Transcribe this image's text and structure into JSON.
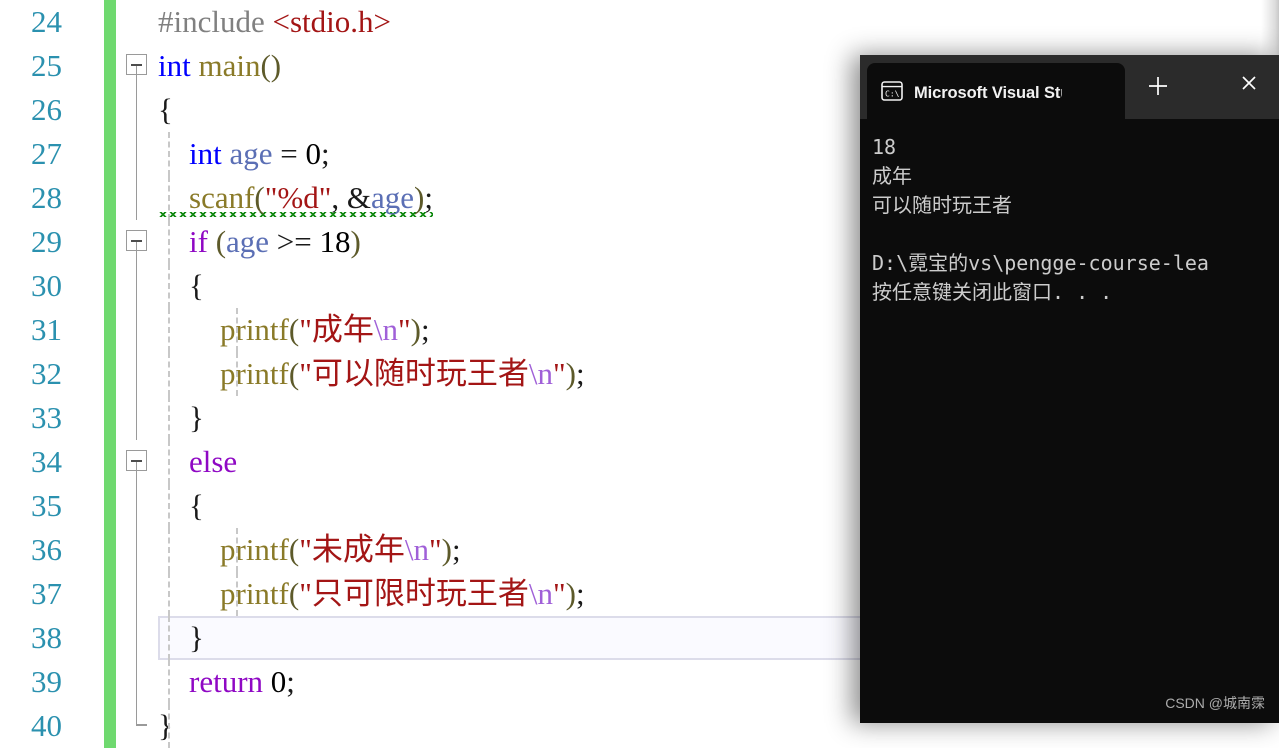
{
  "editor": {
    "name": "visual-studio-code-editor",
    "language": "C",
    "first_visible_line": 24,
    "current_line": 38,
    "colors": {
      "background": "#ffffff",
      "line_number": "#2b91af",
      "change_bar_saved": "#6fd96f",
      "keyword": "#0000ff",
      "control_keyword": "#8f08c4",
      "function": "#8a7a28",
      "string": "#a31515",
      "escape": "#a060d8",
      "preprocessor": "#808080",
      "variable": "#5b6fb5",
      "squiggle_error": "#128a12",
      "current_line_border": "#dcdcea"
    },
    "lines": [
      {
        "num": "24",
        "fold": "none",
        "indent_guides": 0,
        "tokens": [
          {
            "t": "#include ",
            "c": "t-pre"
          },
          {
            "t": "<stdio.h>",
            "c": "t-inc"
          }
        ]
      },
      {
        "num": "25",
        "fold": "open",
        "indent_guides": 0,
        "tokens": [
          {
            "t": "int",
            "c": "t-kw"
          },
          {
            "t": " ",
            "c": "t-punct"
          },
          {
            "t": "main",
            "c": "t-fn"
          },
          {
            "t": "()",
            "c": "t-punct"
          }
        ]
      },
      {
        "num": "26",
        "fold": "line",
        "indent_guides": 0,
        "tokens": [
          {
            "t": "{",
            "c": "t-brace"
          }
        ]
      },
      {
        "num": "27",
        "fold": "line",
        "indent_guides": 1,
        "tokens": [
          {
            "t": "    ",
            "c": "t-punct"
          },
          {
            "t": "int",
            "c": "t-kw"
          },
          {
            "t": " ",
            "c": "t-punct"
          },
          {
            "t": "age",
            "c": "t-var"
          },
          {
            "t": " = ",
            "c": "t-op"
          },
          {
            "t": "0",
            "c": "t-num"
          },
          {
            "t": ";",
            "c": "t-op"
          }
        ]
      },
      {
        "num": "28",
        "fold": "line",
        "indent_guides": 1,
        "squiggle": true,
        "tokens": [
          {
            "t": "    ",
            "c": "t-punct"
          },
          {
            "t": "scanf",
            "c": "t-fn"
          },
          {
            "t": "(",
            "c": "t-punct"
          },
          {
            "t": "\"%d\"",
            "c": "t-str"
          },
          {
            "t": ", ",
            "c": "t-op"
          },
          {
            "t": "&",
            "c": "t-op"
          },
          {
            "t": "age",
            "c": "t-var"
          },
          {
            "t": ")",
            "c": "t-punct"
          },
          {
            "t": ";",
            "c": "t-op"
          }
        ]
      },
      {
        "num": "29",
        "fold": "open",
        "indent_guides": 1,
        "tokens": [
          {
            "t": "    ",
            "c": "t-punct"
          },
          {
            "t": "if",
            "c": "t-ctl"
          },
          {
            "t": " ",
            "c": "t-punct"
          },
          {
            "t": "(",
            "c": "t-punct"
          },
          {
            "t": "age",
            "c": "t-var"
          },
          {
            "t": " >= ",
            "c": "t-op"
          },
          {
            "t": "18",
            "c": "t-num"
          },
          {
            "t": ")",
            "c": "t-punct"
          }
        ]
      },
      {
        "num": "30",
        "fold": "line",
        "indent_guides": 1,
        "tokens": [
          {
            "t": "    ",
            "c": "t-punct"
          },
          {
            "t": "{",
            "c": "t-brace"
          }
        ]
      },
      {
        "num": "31",
        "fold": "line",
        "indent_guides": 2,
        "tokens": [
          {
            "t": "        ",
            "c": "t-punct"
          },
          {
            "t": "printf",
            "c": "t-fn"
          },
          {
            "t": "(",
            "c": "t-punct"
          },
          {
            "t": "\"成年",
            "c": "t-str"
          },
          {
            "t": "\\n",
            "c": "t-esc"
          },
          {
            "t": "\"",
            "c": "t-str"
          },
          {
            "t": ")",
            "c": "t-punct"
          },
          {
            "t": ";",
            "c": "t-op"
          }
        ]
      },
      {
        "num": "32",
        "fold": "line",
        "indent_guides": 2,
        "tokens": [
          {
            "t": "        ",
            "c": "t-punct"
          },
          {
            "t": "printf",
            "c": "t-fn"
          },
          {
            "t": "(",
            "c": "t-punct"
          },
          {
            "t": "\"可以随时玩王者",
            "c": "t-str"
          },
          {
            "t": "\\n",
            "c": "t-esc"
          },
          {
            "t": "\"",
            "c": "t-str"
          },
          {
            "t": ")",
            "c": "t-punct"
          },
          {
            "t": ";",
            "c": "t-op"
          }
        ]
      },
      {
        "num": "33",
        "fold": "line",
        "indent_guides": 1,
        "tokens": [
          {
            "t": "    ",
            "c": "t-punct"
          },
          {
            "t": "}",
            "c": "t-brace"
          }
        ]
      },
      {
        "num": "34",
        "fold": "open",
        "indent_guides": 1,
        "tokens": [
          {
            "t": "    ",
            "c": "t-punct"
          },
          {
            "t": "else",
            "c": "t-ctl"
          }
        ]
      },
      {
        "num": "35",
        "fold": "line",
        "indent_guides": 1,
        "tokens": [
          {
            "t": "    ",
            "c": "t-punct"
          },
          {
            "t": "{",
            "c": "t-brace"
          }
        ]
      },
      {
        "num": "36",
        "fold": "line",
        "indent_guides": 2,
        "tokens": [
          {
            "t": "        ",
            "c": "t-punct"
          },
          {
            "t": "printf",
            "c": "t-fn"
          },
          {
            "t": "(",
            "c": "t-punct"
          },
          {
            "t": "\"未成年",
            "c": "t-str"
          },
          {
            "t": "\\n",
            "c": "t-esc"
          },
          {
            "t": "\"",
            "c": "t-str"
          },
          {
            "t": ")",
            "c": "t-punct"
          },
          {
            "t": ";",
            "c": "t-op"
          }
        ]
      },
      {
        "num": "37",
        "fold": "line",
        "indent_guides": 2,
        "tokens": [
          {
            "t": "        ",
            "c": "t-punct"
          },
          {
            "t": "printf",
            "c": "t-fn"
          },
          {
            "t": "(",
            "c": "t-punct"
          },
          {
            "t": "\"只可限时玩王者",
            "c": "t-str"
          },
          {
            "t": "\\n",
            "c": "t-esc"
          },
          {
            "t": "\"",
            "c": "t-str"
          },
          {
            "t": ")",
            "c": "t-punct"
          },
          {
            "t": ";",
            "c": "t-op"
          }
        ]
      },
      {
        "num": "38",
        "fold": "line",
        "indent_guides": 1,
        "current": true,
        "tokens": [
          {
            "t": "    ",
            "c": "t-punct"
          },
          {
            "t": "}",
            "c": "t-brace"
          }
        ]
      },
      {
        "num": "39",
        "fold": "line",
        "indent_guides": 1,
        "tokens": [
          {
            "t": "    ",
            "c": "t-ctl"
          },
          {
            "t": "return",
            "c": "t-ctl"
          },
          {
            "t": " ",
            "c": "t-punct"
          },
          {
            "t": "0",
            "c": "t-num"
          },
          {
            "t": ";",
            "c": "t-op"
          }
        ]
      },
      {
        "num": "40",
        "fold": "endbrace",
        "indent_guides": 1,
        "tokens": [
          {
            "t": "}",
            "c": "t-brace"
          }
        ]
      }
    ]
  },
  "console": {
    "window_name": "visual-studio-debug-console",
    "tab": {
      "icon": "command-prompt-icon",
      "title": "Microsoft Visual Studio 调试控制台",
      "close_label": "✕",
      "new_tab_label": "+"
    },
    "background": "#0c0c0c",
    "titlebar_background": "#2b2b2b",
    "text_color": "#cccccc",
    "output_lines": [
      "18",
      "成年",
      "可以随时玩王者",
      "",
      "D:\\霓宝的vs\\pengge-course-lea",
      "按任意键关闭此窗口. . ."
    ]
  },
  "watermark": {
    "text": "CSDN @城南霂"
  }
}
